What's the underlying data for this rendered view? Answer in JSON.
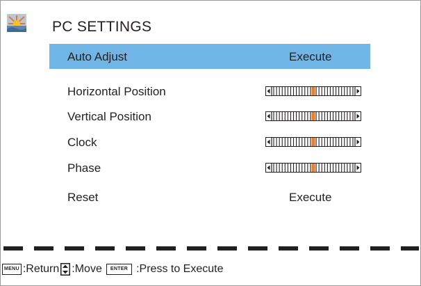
{
  "header": {
    "title": "PC SETTINGS",
    "logo_icon": "pc-settings-logo-icon"
  },
  "menu": {
    "selected_index": 0,
    "selected_color": "#6fb6e6",
    "items": [
      {
        "label": "Auto Adjust",
        "control": "action",
        "value": "Execute"
      },
      {
        "label": "Horizontal Position",
        "control": "slider",
        "level": 0.5
      },
      {
        "label": "Vertical Position",
        "control": "slider",
        "level": 0.5
      },
      {
        "label": "Clock",
        "control": "slider",
        "level": 0.5
      },
      {
        "label": "Phase",
        "control": "slider",
        "level": 0.5
      },
      {
        "label": "Reset",
        "control": "action",
        "value": "Execute"
      }
    ]
  },
  "slider_style": {
    "indicator_color": "#ef7d22",
    "icon": "left-right-arrows"
  },
  "footer": {
    "menu_key": "MENU",
    "return_text": ":Return",
    "move_icon": "up-down-arrows-icon",
    "move_text": ":Move",
    "enter_key": "ENTER",
    "execute_text": ":Press to Execute"
  }
}
